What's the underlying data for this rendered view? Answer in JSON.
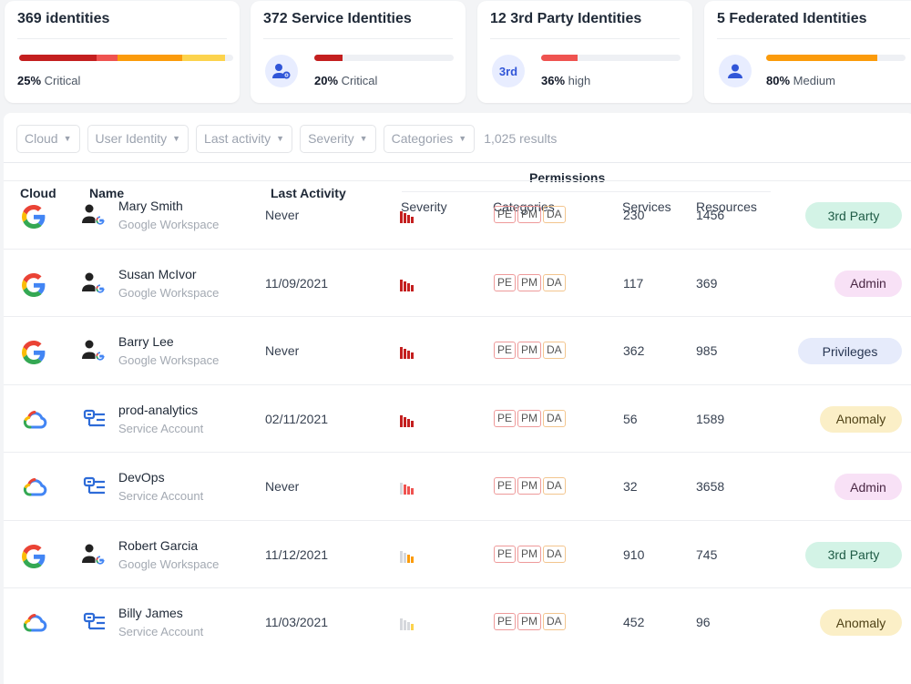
{
  "cards": [
    {
      "count": "369",
      "label": "identities",
      "pct": "25%",
      "severity": "Critical",
      "icon": "",
      "bar": [
        0.36,
        0.1,
        0.3,
        0.2
      ]
    },
    {
      "count": "372",
      "label": "Service Identities",
      "pct": "20%",
      "severity": "Critical",
      "icon": "user-gear-icon",
      "fill": 0.2,
      "color": "#c41f1f"
    },
    {
      "count": "12",
      "label": "3rd Party Identities",
      "pct": "36%",
      "severity": "high",
      "icon": "third-party-icon",
      "icon_text": "3rd",
      "fill": 0.26,
      "color": "#ef5350"
    },
    {
      "count": "5",
      "label": "Federated Identities",
      "pct": "80%",
      "severity": "Medium",
      "icon": "user-icon",
      "fill": 0.8,
      "color": "#fb9b0b"
    }
  ],
  "filters": {
    "cloud": "Cloud",
    "user_identity": "User Identity",
    "last_activity": "Last activity",
    "severity": "Severity",
    "categories": "Categories",
    "results": "1,025 results"
  },
  "columns": {
    "cloud": "Cloud",
    "name": "Name",
    "last_activity": "Last Activity",
    "permissions": "Permissions",
    "severity": "Severity",
    "categories": "Categories",
    "services": "Services",
    "resources": "Resources"
  },
  "category_tags": {
    "pe": "PE",
    "pm": "PM",
    "da": "DA"
  },
  "rows": [
    {
      "cloud_icon": "google-icon",
      "identity_icon": "user-google-icon",
      "name": "Mary Smith",
      "source": "Google Workspace",
      "last_activity": "Never",
      "severity_level": 4,
      "services": "230",
      "resources": "1456",
      "tag": "3rd Party",
      "tag_bg": "#d3f3e6",
      "tag_fg": "#1e5b45"
    },
    {
      "cloud_icon": "google-icon",
      "identity_icon": "user-google-icon",
      "name": "Susan McIvor",
      "source": "Google Workspace",
      "last_activity": "11/09/2021",
      "severity_level": 4,
      "services": "117",
      "resources": "369",
      "tag": "Admin",
      "tag_bg": "#f8e1f6",
      "tag_fg": "#4a2744"
    },
    {
      "cloud_icon": "google-icon",
      "identity_icon": "user-google-icon",
      "name": "Barry Lee",
      "source": "Google Workspace",
      "last_activity": "Never",
      "severity_level": 4,
      "services": "362",
      "resources": "985",
      "tag": "Privileges",
      "tag_bg": "#e6ebfb",
      "tag_fg": "#273552"
    },
    {
      "cloud_icon": "google-cloud-icon",
      "identity_icon": "service-account-icon",
      "name": "prod-analytics",
      "source": "Service Account",
      "last_activity": "02/11/2021",
      "severity_level": 4,
      "services": "56",
      "resources": "1589",
      "tag": "Anomaly",
      "tag_bg": "#fbefc7",
      "tag_fg": "#4f4216"
    },
    {
      "cloud_icon": "google-cloud-icon",
      "identity_icon": "service-account-icon",
      "name": "DevOps",
      "source": "Service Account",
      "last_activity": "Never",
      "severity_level": 3,
      "services": "32",
      "resources": "3658",
      "tag": "Admin",
      "tag_bg": "#f8e1f6",
      "tag_fg": "#4a2744"
    },
    {
      "cloud_icon": "google-icon",
      "identity_icon": "user-google-icon",
      "name": "Robert Garcia",
      "source": "Google Workspace",
      "last_activity": "11/12/2021",
      "severity_level": 2,
      "services": "910",
      "resources": "745",
      "tag": "3rd Party",
      "tag_bg": "#d3f3e6",
      "tag_fg": "#1e5b45"
    },
    {
      "cloud_icon": "google-cloud-icon",
      "identity_icon": "service-account-icon",
      "name": "Billy James",
      "source": "Service Account",
      "last_activity": "11/03/2021",
      "severity_level": 1,
      "services": "452",
      "resources": "96",
      "tag": "Anomaly",
      "tag_bg": "#fbefc7",
      "tag_fg": "#4f4216"
    }
  ],
  "colors": {
    "critical": "#c41f1f",
    "high": "#ef5350",
    "medium": "#fb9b0b",
    "low": "#fcd34d",
    "muted": "#d6d8dc"
  }
}
